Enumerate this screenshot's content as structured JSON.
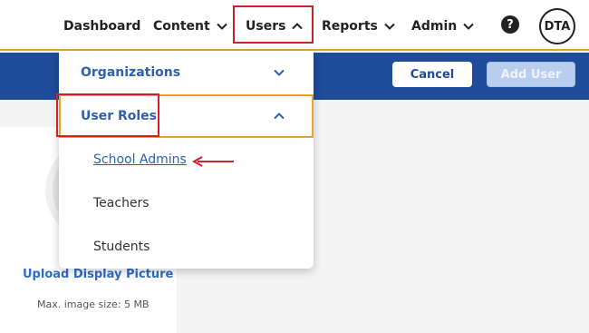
{
  "nav": {
    "dashboard": "Dashboard",
    "content": "Content",
    "users": "Users",
    "reports": "Reports",
    "admin": "Admin",
    "help_glyph": "?",
    "avatar_initials": "DTA"
  },
  "toolbar": {
    "cancel_label": "Cancel",
    "add_user_label": "Add User"
  },
  "dropdown": {
    "organizations": "Organizations",
    "user_roles": "User Roles",
    "items": [
      "School Admins",
      "Teachers",
      "Students"
    ]
  },
  "profile": {
    "upload_label": "Upload Display Picture",
    "max_size": "Max. image size: 5 MB"
  },
  "colors": {
    "brand_blue": "#1e4c9a",
    "accent_orange": "#e8a52e",
    "highlight_red": "#d0202a",
    "link_blue": "#2f5fb5"
  },
  "icons": {
    "help": "help-icon",
    "chevron_down": "chevron-down-icon",
    "chevron_up": "chevron-up-icon",
    "annotation_arrow": "arrow-left-icon"
  }
}
